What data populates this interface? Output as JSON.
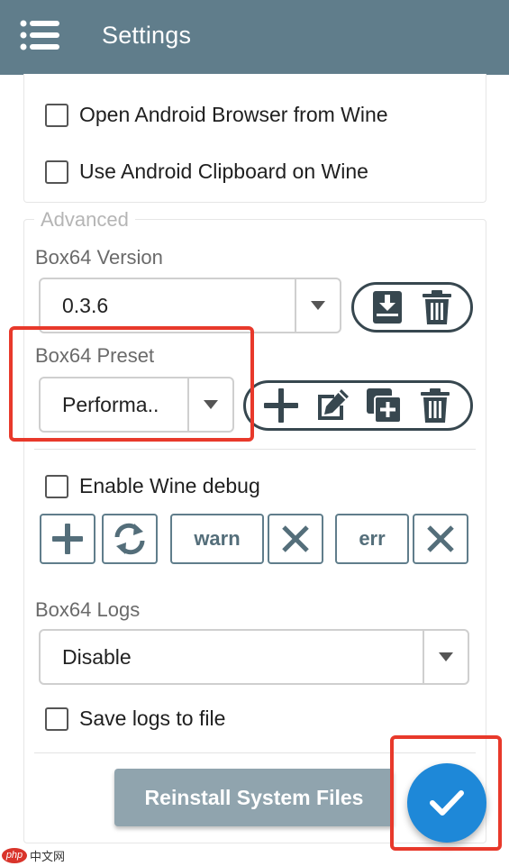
{
  "appbar": {
    "title": "Settings"
  },
  "top_options": {
    "open_browser": {
      "label": "Open Android Browser from Wine",
      "checked": false
    },
    "use_clipboard": {
      "label": "Use Android Clipboard on Wine",
      "checked": false
    }
  },
  "advanced": {
    "legend": "Advanced",
    "box64_version": {
      "label": "Box64 Version",
      "value": "0.3.6"
    },
    "box64_preset": {
      "label": "Box64 Preset",
      "value": "Performa.."
    },
    "wine_debug": {
      "label": "Enable Wine debug",
      "checked": false,
      "channels": [
        "warn",
        "err"
      ]
    },
    "box64_logs": {
      "label": "Box64 Logs",
      "value": "Disable"
    },
    "save_logs": {
      "label": "Save logs to file",
      "checked": false
    },
    "reinstall_label": "Reinstall System Files"
  },
  "watermark": {
    "badge": "php",
    "text": "中文网"
  },
  "colors": {
    "appbar": "#607d8b",
    "fab": "#1e88d8",
    "reinstall": "#90a4ae",
    "highlight": "#e8392b",
    "icon_dark": "#37474f"
  },
  "icons": [
    "menu-icon",
    "download-icon",
    "trash-icon",
    "plus-icon",
    "edit-icon",
    "duplicate-icon",
    "sync-icon",
    "close-icon",
    "check-icon"
  ]
}
